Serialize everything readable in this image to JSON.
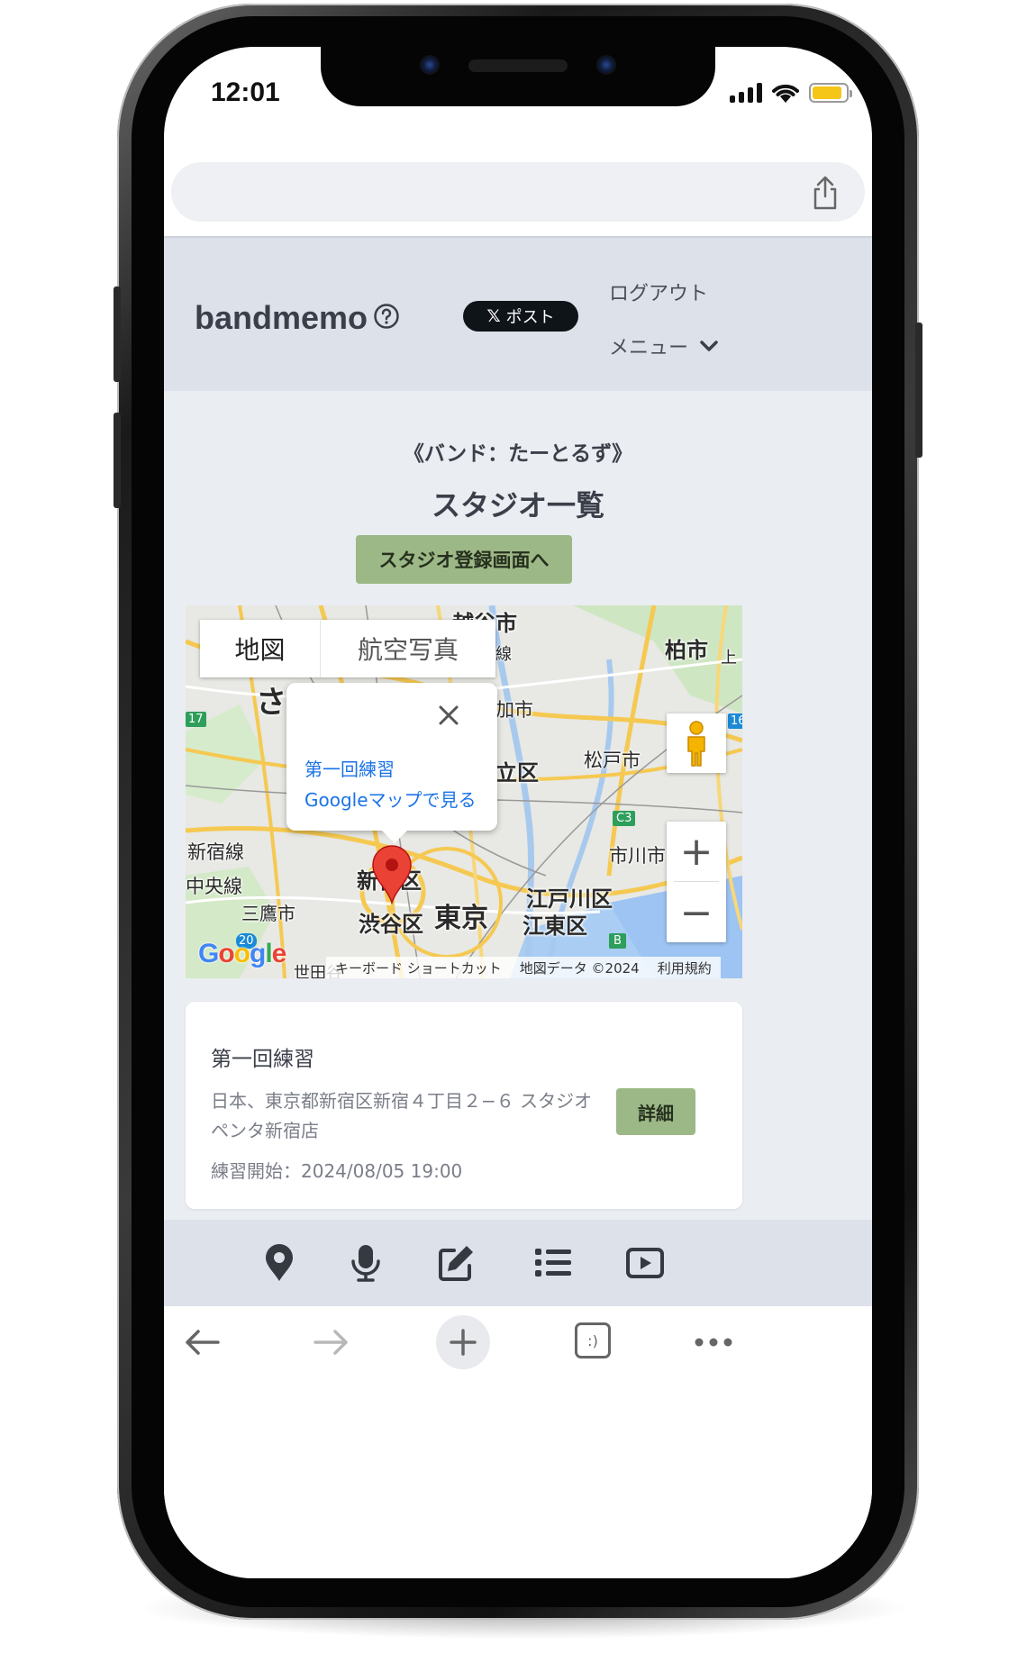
{
  "status_bar": {
    "time": "12:01",
    "battery_level": 0.9
  },
  "header": {
    "logo": "bandmemo",
    "x_post_label": "ポスト",
    "x_icon": "𝕏",
    "logout_label": "ログアウト",
    "menu_label": "メニュー"
  },
  "page": {
    "band_name": "《バンド：たーとるず》",
    "title": "スタジオ一覧",
    "register_button": "スタジオ登録画面へ"
  },
  "map": {
    "tabs": {
      "map": "地図",
      "satellite": "航空写真"
    },
    "info_window": {
      "title": "第一回練習",
      "link": "Googleマップで見る"
    },
    "zoom_in": "+",
    "zoom_out": "−",
    "labels": {
      "koshigaya": "越谷市",
      "kashiwa": "柏市",
      "sa": "さ",
      "kamo": "加市",
      "matsudo": "松戸市",
      "ku_adachi": "立区",
      "shinjuku_line": "新宿線",
      "chuo_line": "中央線",
      "mitaka": "三鷹市",
      "shinjuku_ku": "新宿区",
      "shibuya_ku": "渋谷区",
      "tokyo": "東京",
      "edogawa": "江戸川区",
      "koto": "江東区",
      "ichikawa": "市川市",
      "sen": "線",
      "road17": "17",
      "road16": "16",
      "roadC3": "C3",
      "road20": "20",
      "roadB": "B",
      "ue": "上",
      "setagaya": "世田谷"
    },
    "google_logo": "Google",
    "attribution": {
      "keyboard": "キーボード ショートカット",
      "data": "地図データ ©2024",
      "terms": "利用規約"
    }
  },
  "studios": [
    {
      "name": "第一回練習",
      "address": "日本、東京都新宿区新宿４丁目２−６ スタジオペンタ新宿店",
      "start": "練習開始：2024/08/05 19:00",
      "detail_button": "詳細"
    }
  ],
  "bottom_nav": [
    "map-pin-icon",
    "microphone-icon",
    "edit-icon",
    "list-icon",
    "video-icon"
  ],
  "browser_toolbar": [
    "back-icon",
    "forward-icon",
    "new-tab-icon",
    "tabs-icon",
    "more-icon"
  ],
  "browser_tabs_label": ":)"
}
